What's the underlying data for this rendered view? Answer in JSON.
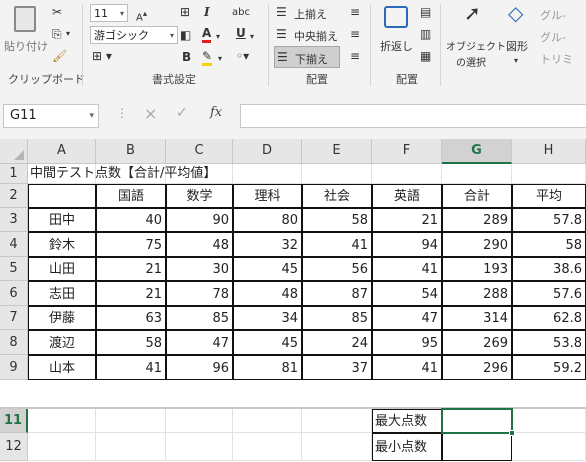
{
  "ribbon": {
    "paste_label": "貼り付け",
    "clipboard_group": "クリップボード",
    "font_size": "11",
    "font_name": "游ゴシック",
    "bold": "B",
    "italic": "I",
    "underline": "U",
    "strike": "abc",
    "font_group": "書式設定",
    "align_top": "上揃え",
    "align_middle": "中央揃え",
    "align_bottom": "下揃え",
    "align_group": "配置",
    "wrap_label": "折返し",
    "wrap_group": "配置",
    "select_objects_line1": "オブジェクト",
    "select_objects_line2": "の選択",
    "shapes_label": "図形",
    "group1": "グル-",
    "group2": "グル-",
    "trim": "トリミ"
  },
  "formula_bar": {
    "name_box": "G11",
    "cancel": "×",
    "enter": "✓",
    "fx": "fx",
    "formula": ""
  },
  "columns": [
    "A",
    "B",
    "C",
    "D",
    "E",
    "F",
    "G",
    "H"
  ],
  "rows": [
    "1",
    "2",
    "3",
    "4",
    "5",
    "6",
    "7",
    "8",
    "9",
    "11",
    "12"
  ],
  "sheet": {
    "title": "中間テスト点数【合計/平均値】",
    "headers": [
      "国語",
      "数学",
      "理科",
      "社会",
      "英語",
      "合計",
      "平均"
    ],
    "students": [
      {
        "name": "田中",
        "scores": [
          "40",
          "90",
          "80",
          "58",
          "21"
        ],
        "total": "289",
        "avg": "57.8"
      },
      {
        "name": "鈴木",
        "scores": [
          "75",
          "48",
          "32",
          "41",
          "94"
        ],
        "total": "290",
        "avg": "58"
      },
      {
        "name": "山田",
        "scores": [
          "21",
          "30",
          "45",
          "56",
          "41"
        ],
        "total": "193",
        "avg": "38.6"
      },
      {
        "name": "志田",
        "scores": [
          "21",
          "78",
          "48",
          "87",
          "54"
        ],
        "total": "288",
        "avg": "57.6"
      },
      {
        "name": "伊藤",
        "scores": [
          "63",
          "85",
          "34",
          "85",
          "47"
        ],
        "total": "314",
        "avg": "62.8"
      },
      {
        "name": "渡辺",
        "scores": [
          "58",
          "47",
          "45",
          "24",
          "95"
        ],
        "total": "269",
        "avg": "53.8"
      },
      {
        "name": "山本",
        "scores": [
          "41",
          "96",
          "81",
          "37",
          "41"
        ],
        "total": "296",
        "avg": "59.2"
      }
    ],
    "max_label": "最大点数",
    "min_label": "最小点数"
  },
  "colors": {
    "selection": "#217346",
    "ribbon_bg": "#f3f3f3",
    "header_bg": "#e6e6e6"
  }
}
